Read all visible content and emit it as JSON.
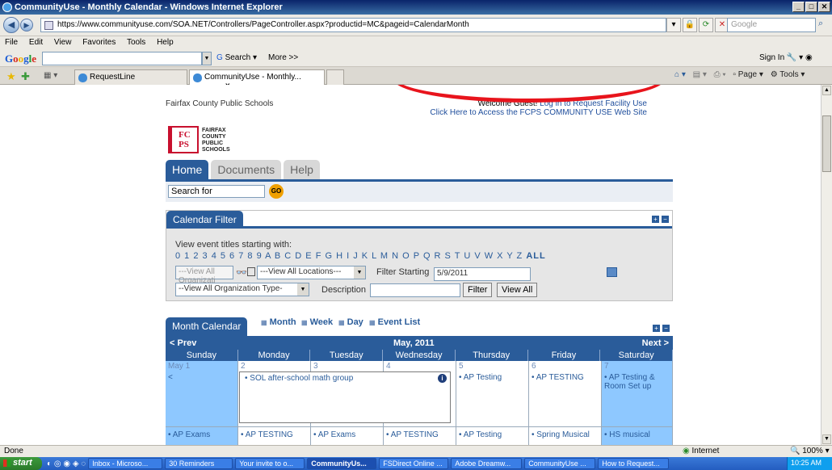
{
  "window": {
    "title": "CommunityUse - Monthly Calendar - Windows Internet Explorer"
  },
  "address": {
    "url": "https://www.communityuse.com/SOA.NET/Controllers/PageController.aspx?productid=MC&pageid=CalendarMonth",
    "search_placeholder": "Google"
  },
  "menu": [
    "File",
    "Edit",
    "View",
    "Favorites",
    "Tools",
    "Help"
  ],
  "google_bar": {
    "search_label": "Search",
    "more_label": "More >>",
    "signin_label": "Sign In"
  },
  "tabs": [
    {
      "label": "RequestLine"
    },
    {
      "label": "CommunityUse - Monthly...",
      "close": "x"
    }
  ],
  "cmdbar": {
    "page_label": "Page",
    "tools_label": "Tools"
  },
  "page": {
    "org_name": "Fairfax County Public Schools",
    "welcome": "Welcome Guest!",
    "login_link": "Log in to Request Facility Use",
    "site_link": "Click Here to Access the FCPS COMMUNITY USE Web Site",
    "logo_letters": "FC PS",
    "logo_text": "FAIRFAX COUNTY PUBLIC SCHOOLS",
    "nav_tabs": [
      "Home",
      "Documents",
      "Help"
    ],
    "search_value": "Search for",
    "go_label": "GO"
  },
  "filter": {
    "title": "Calendar Filter",
    "starting_with_label": "View event titles starting with:",
    "alphabet_digits": "0 1 2 3 4 5 6 7 8 9 A B C D E F G H I J K L M N O P Q R S T U V W X Y Z",
    "all_label": "ALL",
    "org_select": "---View All Organizati",
    "location_select": "---View All Locations---",
    "filter_starting_label": "Filter Starting",
    "filter_starting_value": "5/9/2011",
    "org_type_select": "--View All Organization Type-",
    "description_label": "Description",
    "filter_button": "Filter",
    "view_all_button": "View All"
  },
  "calendar": {
    "tab_title": "Month Calendar",
    "views": [
      "Month",
      "Week",
      "Day",
      "Event List"
    ],
    "prev_label": "< Prev",
    "next_label": "Next >",
    "month_title": "May, 2011",
    "days": [
      "Sunday",
      "Monday",
      "Tuesday",
      "Wednesday",
      "Thursday",
      "Friday",
      "Saturday"
    ],
    "week1": [
      {
        "num": "May 1",
        "events": [
          "<"
        ]
      },
      {
        "num": "2",
        "events": [
          "SOL after-school math group"
        ]
      },
      {
        "num": "3",
        "events": []
      },
      {
        "num": "4",
        "events": []
      },
      {
        "num": "5",
        "events": [
          "AP Testing"
        ]
      },
      {
        "num": "6",
        "events": [
          "AP TESTING"
        ]
      },
      {
        "num": "7",
        "events": [
          "AP Testing & Room Set up"
        ]
      }
    ],
    "week2": [
      "AP Exams",
      "AP TESTING",
      "AP Exams",
      "AP TESTING",
      "AP Testing",
      "Spring Musical",
      "HS musical"
    ]
  },
  "status": {
    "left": "Done",
    "zone": "Internet",
    "zoom": "100%"
  },
  "taskbar": {
    "start": "start",
    "buttons": [
      "Inbox - Microso...",
      "30 Reminders",
      "Your invite to o...",
      "CommunityUs...",
      "FSDirect Online ...",
      "Adobe Dreamw...",
      "CommunityUse ...",
      "How to Request..."
    ],
    "clock": "10:25 AM"
  },
  "colors": {
    "accent": "#2a5c9a",
    "highlight_ring": "#e8141c",
    "weekend": "#8ec8ff"
  }
}
